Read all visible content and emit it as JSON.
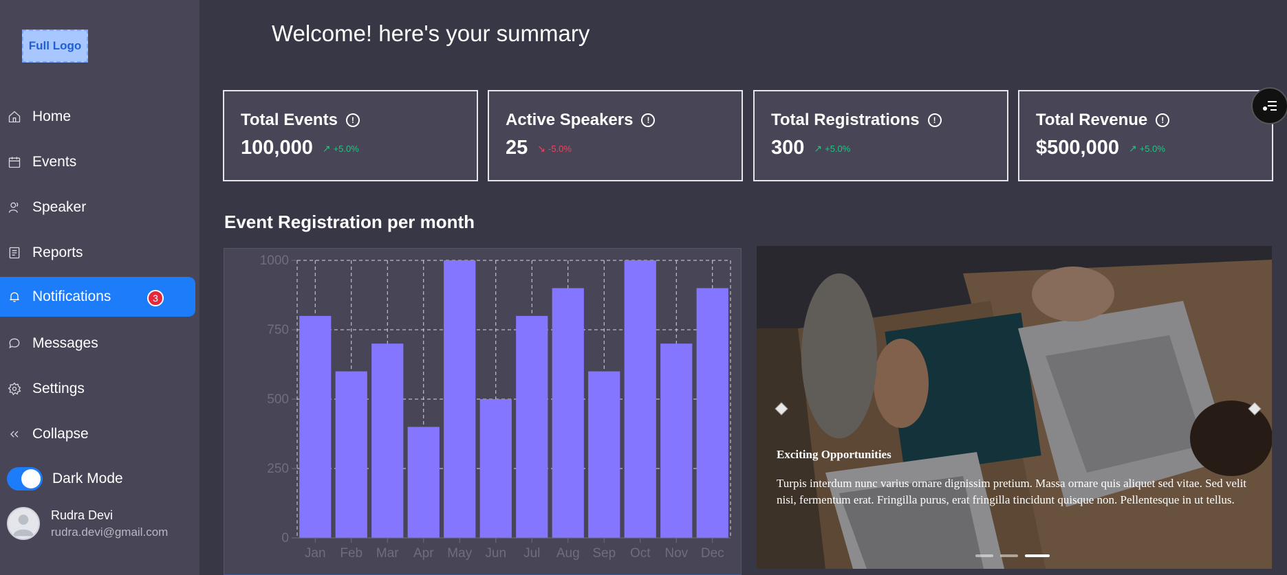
{
  "sidebar": {
    "logo": "Full Logo",
    "items": [
      {
        "label": "Home",
        "icon": "home-icon"
      },
      {
        "label": "Events",
        "icon": "calendar-icon"
      },
      {
        "label": "Speaker",
        "icon": "speaker-icon"
      },
      {
        "label": "Reports",
        "icon": "report-icon"
      },
      {
        "label": "Notifications",
        "icon": "bell-icon",
        "badge": "3",
        "active": true
      },
      {
        "label": "Messages",
        "icon": "message-icon"
      },
      {
        "label": "Settings",
        "icon": "gear-icon"
      },
      {
        "label": "Collapse",
        "icon": "double-chevron-left-icon"
      }
    ],
    "dark_mode_label": "Dark Mode",
    "dark_mode_on": true,
    "user": {
      "name": "Rudra Devi",
      "email": "rudra.devi@gmail.com"
    }
  },
  "header": {
    "welcome": "Welcome! here's your summary"
  },
  "stats": [
    {
      "title": "Total Events",
      "value": "100,000",
      "trend": "+5.0%",
      "direction": "up"
    },
    {
      "title": "Active Speakers",
      "value": "25",
      "trend": "-5.0%",
      "direction": "down"
    },
    {
      "title": "Total Registrations",
      "value": "300",
      "trend": "+5.0%",
      "direction": "up"
    },
    {
      "title": "Total Revenue",
      "value": "$500,000",
      "trend": "+5.0%",
      "direction": "up"
    }
  ],
  "section_title": "Event Registration per month",
  "chart_data": {
    "type": "bar",
    "categories": [
      "Jan",
      "Feb",
      "Mar",
      "Apr",
      "May",
      "Jun",
      "Jul",
      "Aug",
      "Sep",
      "Oct",
      "Nov",
      "Dec"
    ],
    "values": [
      800,
      600,
      700,
      400,
      1000,
      500,
      800,
      900,
      600,
      1000,
      700,
      900
    ],
    "ylim": [
      0,
      1000
    ],
    "yticks": [
      0,
      250,
      500,
      750,
      1000
    ],
    "grid": true,
    "color": "#8576ff"
  },
  "carousel": {
    "title": "Exciting Opportunities",
    "body": "Turpis interdum nunc varius ornare dignissim pretium. Massa ornare quis aliquet sed vitae. Sed velit nisi, fermentum erat. Fringilla purus, erat fringilla tincidunt quisque non. Pellentesque in ut tellus.",
    "slide_count": 3,
    "active_slide": 3
  },
  "colors": {
    "accent": "#1c7cf9",
    "up": "#27c281",
    "down": "#f0435c",
    "bar": "#8576ff"
  }
}
